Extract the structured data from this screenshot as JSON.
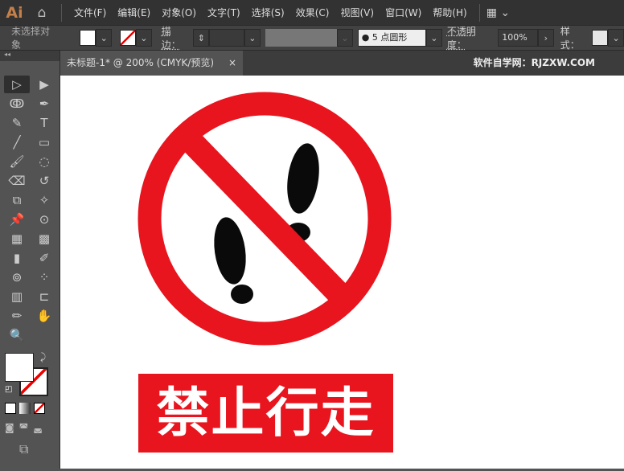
{
  "app": {
    "logo": "Ai"
  },
  "menu": [
    "文件(F)",
    "编辑(E)",
    "对象(O)",
    "文字(T)",
    "选择(S)",
    "效果(C)",
    "视图(V)",
    "窗口(W)",
    "帮助(H)"
  ],
  "control": {
    "selection": "未选择对象",
    "stroke_label": "描边：",
    "brush": "5 点圆形",
    "opacity_label": "不透明度：",
    "opacity": "100%",
    "style_label": "样式："
  },
  "tab": {
    "title": "未标题-1* @ 200% (CMYK/预览)",
    "close": "×"
  },
  "watermark": "软件自学网：RJZXW.COM",
  "tools": [
    "▷",
    "▶",
    "ↂ",
    "✒",
    "✎",
    "T",
    "╱",
    "▭",
    "🖌",
    "◌",
    "⌫",
    "↺",
    "⧉",
    "✧",
    "📌",
    "⊙",
    "▦",
    "▩",
    "▮",
    "✐",
    "⊚",
    "⁘",
    "▥",
    "⊏",
    "✏",
    "✋",
    "🔍"
  ],
  "sign": {
    "text": "禁止行走",
    "red": "#e8141e"
  }
}
